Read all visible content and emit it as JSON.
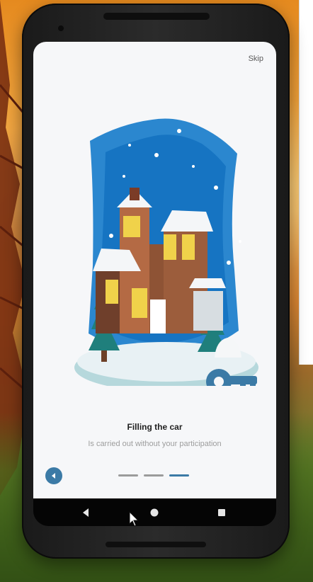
{
  "onboarding": {
    "skip_label": "Skip",
    "title": "Filling the car",
    "subtitle": "Is carried out without your participation",
    "pages_total": 3,
    "current_page": 3
  },
  "colors": {
    "accent": "#3b7aa6",
    "title_text": "#1f1f1f",
    "subtitle_text": "#9d9d9d",
    "background": "#f6f7f9"
  },
  "icons": {
    "back": "left-triangle-icon",
    "key": "key-icon",
    "android_back": "android-back-icon",
    "android_home": "android-home-icon",
    "android_recent": "android-recent-icon"
  }
}
